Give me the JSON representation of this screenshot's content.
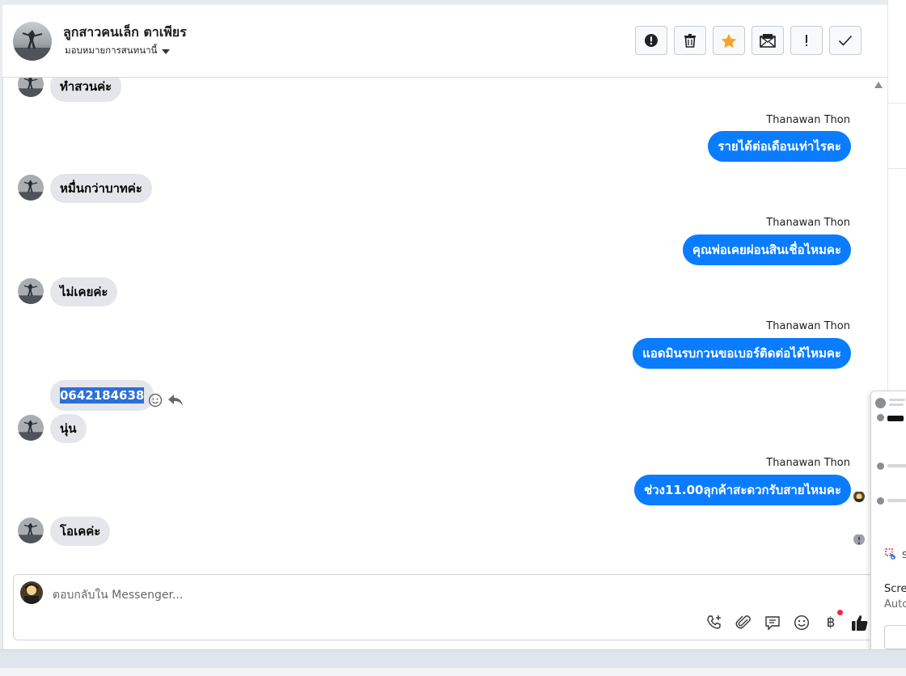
{
  "header": {
    "contact_name": "ลูกสาวคนเล็ก ตาเพียร",
    "assign_label": "มอบหมายการสนทนานี้"
  },
  "toolbar": {
    "buttons": [
      "alert-icon",
      "trash-icon",
      "star-icon",
      "mark-unread-icon",
      "exclamation-icon",
      "check-icon"
    ],
    "star_color": "#f7a325"
  },
  "messages": [
    {
      "dir": "in",
      "text": "ทำสวนค่ะ"
    },
    {
      "dir": "out",
      "sender": "Thanawan Thon",
      "text": "รายได้ต่อเดือนเท่าไรคะ"
    },
    {
      "dir": "in",
      "text": "หมื่นกว่าบาทค่ะ"
    },
    {
      "dir": "out",
      "sender": "Thanawan Thon",
      "text": "คุณพ่อเคยผ่อนสินเชื่อไหมคะ"
    },
    {
      "dir": "in",
      "text": "ไม่เคยค่ะ"
    },
    {
      "dir": "out",
      "sender": "Thanawan Thon",
      "text": "แอดมินรบกวนขอเบอร์ติดต่อได้ไหมคะ"
    },
    {
      "dir": "in",
      "text": "0642184638",
      "selected": true
    },
    {
      "dir": "in",
      "text": "นุ่น"
    },
    {
      "dir": "out",
      "sender": "Thanawan Thon",
      "text": "ช่วง11.00ลุกค้าสะดวกรับสายไหมคะ"
    },
    {
      "dir": "in",
      "text": "โอเคค่ะ"
    }
  ],
  "composer": {
    "placeholder": "ตอบกลับใน Messenger...",
    "tools": [
      "call-add-icon",
      "attachment-icon",
      "saved-reply-icon",
      "emoji-icon",
      "payment-icon",
      "like-icon"
    ],
    "payment_symbol": "฿"
  },
  "popup": {
    "title": "Scree",
    "subtitle": "Auto",
    "label": "S"
  },
  "colors": {
    "accent": "#0a7cff",
    "incoming_bubble": "#e4e6eb",
    "selection": "#2d6fd6",
    "notification": "#f02849"
  }
}
